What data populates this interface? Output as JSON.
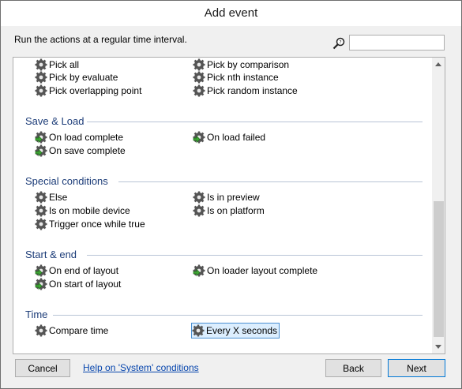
{
  "window": {
    "title": "Add event"
  },
  "description": "Run the actions at a regular time interval.",
  "search": {
    "value": "",
    "placeholder": "",
    "icon": "search-icon"
  },
  "categories": [
    {
      "name": "",
      "items": [
        {
          "label": "Pick all",
          "icon": "gear-icon"
        },
        {
          "label": "Pick by comparison",
          "icon": "gear-icon"
        },
        {
          "label": "Pick by evaluate",
          "icon": "gear-icon"
        },
        {
          "label": "Pick nth instance",
          "icon": "gear-icon"
        },
        {
          "label": "Pick overlapping point",
          "icon": "gear-icon"
        },
        {
          "label": "Pick random instance",
          "icon": "gear-icon"
        }
      ]
    },
    {
      "name": "Save & Load",
      "items": [
        {
          "label": "On load complete",
          "icon": "trigger-gear-icon"
        },
        {
          "label": "On load failed",
          "icon": "trigger-gear-icon"
        },
        {
          "label": "On save complete",
          "icon": "trigger-gear-icon"
        }
      ]
    },
    {
      "name": "Special conditions",
      "items": [
        {
          "label": "Else",
          "icon": "gear-icon"
        },
        {
          "label": "Is in preview",
          "icon": "gear-icon"
        },
        {
          "label": "Is on mobile device",
          "icon": "gear-icon"
        },
        {
          "label": "Is on platform",
          "icon": "gear-icon"
        },
        {
          "label": "Trigger once while true",
          "icon": "gear-icon"
        }
      ]
    },
    {
      "name": "Start & end",
      "items": [
        {
          "label": "On end of layout",
          "icon": "trigger-gear-icon"
        },
        {
          "label": "On loader layout complete",
          "icon": "trigger-gear-icon"
        },
        {
          "label": "On start of layout",
          "icon": "trigger-gear-icon"
        }
      ]
    },
    {
      "name": "Time",
      "items": [
        {
          "label": "Compare time",
          "icon": "gear-icon"
        },
        {
          "label": "Every X seconds",
          "icon": "gear-icon",
          "selected": true
        }
      ]
    }
  ],
  "footer": {
    "cancel": "Cancel",
    "help": "Help on 'System' conditions",
    "back": "Back",
    "next": "Next"
  },
  "colors": {
    "category": "#1c3c78",
    "link": "#0645ad",
    "selection": "#dceefe"
  }
}
